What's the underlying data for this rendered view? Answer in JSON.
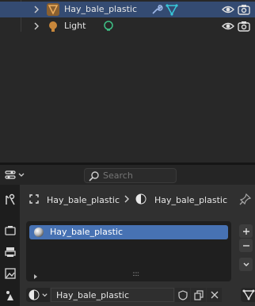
{
  "outliner": {
    "rows": [
      {
        "label": "Hay_bale_plastic",
        "selected": true,
        "type": "mesh"
      },
      {
        "label": "Light",
        "selected": false,
        "type": "light"
      }
    ]
  },
  "properties": {
    "search": {
      "placeholder": "Search"
    },
    "breadcrumb": {
      "object": "Hay_bale_plastic",
      "material": "Hay_bale_plastic"
    },
    "material_slots": [
      {
        "label": "Hay_bale_plastic"
      }
    ],
    "material_name": "Hay_bale_plastic",
    "drag_handle": "::::"
  },
  "colors": {
    "selection_blue": "#4772b3",
    "row_selected": "#344b72",
    "mesh_orange": "#e9a04f",
    "modifier_cyan": "#38c7d9",
    "constraint_green": "#3ec186"
  }
}
